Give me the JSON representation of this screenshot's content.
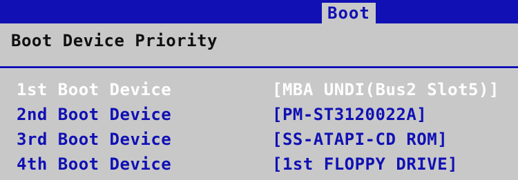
{
  "menu": {
    "active_tab": "Boot"
  },
  "section": {
    "title": "Boot Device Priority"
  },
  "boot_devices": [
    {
      "label": "1st Boot Device",
      "value": "[MBA UNDI(Bus2 Slot5)]"
    },
    {
      "label": "2nd Boot Device",
      "value": "[PM-ST3120022A]"
    },
    {
      "label": "3rd Boot Device",
      "value": "[SS-ATAPI-CD ROM]"
    },
    {
      "label": "4th Boot Device",
      "value": "[1st FLOPPY DRIVE]"
    }
  ],
  "colors": {
    "bios_blue": "#1010b4",
    "bios_gray": "#c8c8c8",
    "highlight_text": "#ffffff"
  }
}
